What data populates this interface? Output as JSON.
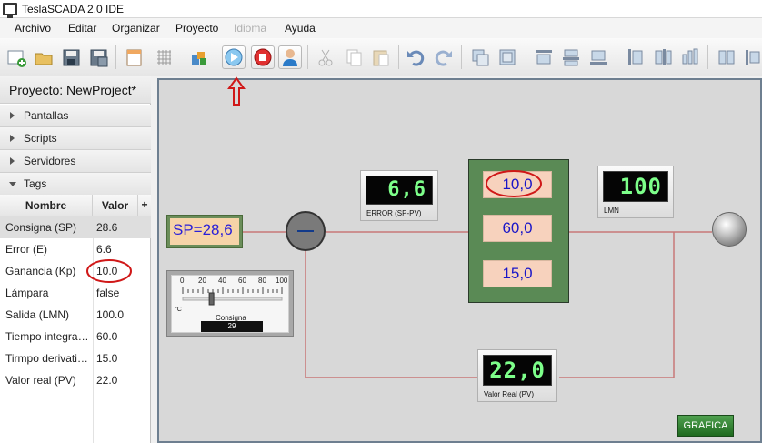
{
  "window": {
    "title": "TeslaSCADA 2.0 IDE"
  },
  "menu": [
    {
      "label": "Archivo",
      "enabled": true
    },
    {
      "label": "Editar",
      "enabled": true
    },
    {
      "label": "Organizar",
      "enabled": true
    },
    {
      "label": "Proyecto",
      "enabled": true
    },
    {
      "label": "Idioma",
      "enabled": false
    },
    {
      "label": "Ayuda",
      "enabled": true
    }
  ],
  "toolbar": {
    "buttons": [
      "new-icon",
      "open-icon",
      "save-icon",
      "save-all-icon",
      "screen-icon",
      "grid-icon",
      "components-icon",
      "run-icon",
      "stop-icon",
      "user-icon",
      "cut-icon",
      "copy-icon",
      "paste-icon",
      "undo-icon",
      "redo-icon",
      "group-icon",
      "ungroup-icon",
      "align-top-icon",
      "align-middle-icon",
      "align-bottom-icon",
      "align-left-icon",
      "align-center-icon",
      "align-right-icon",
      "distribute-icon",
      "more-icon"
    ]
  },
  "left_panel": {
    "project_title": "Proyecto: NewProject*",
    "sections": [
      "Pantallas",
      "Scripts",
      "Servidores",
      "Tags"
    ],
    "tags_table": {
      "headers": {
        "name": "Nombre",
        "value": "Valor",
        "add": "+"
      },
      "rows": [
        {
          "name": "Consigna (SP)",
          "value": "28.6"
        },
        {
          "name": "Error (E)",
          "value": "6.6"
        },
        {
          "name": "Ganancia (Kp)",
          "value": "10.0"
        },
        {
          "name": "Lámpara",
          "value": "false"
        },
        {
          "name": "Salida (LMN)",
          "value": "100.0"
        },
        {
          "name": "Tiempo integral (Ti)",
          "value": "60.0"
        },
        {
          "name": "Tirmpo derivativo (Td)",
          "value": "15.0"
        },
        {
          "name": "Valor real (PV)",
          "value": "22.0"
        }
      ]
    }
  },
  "canvas": {
    "sp_display": "SP=28,6",
    "error_display": {
      "value": "6,6",
      "label": "ERROR (SP-PV)"
    },
    "pid": {
      "kp": "10,0",
      "ti": "60,0",
      "td": "15,0"
    },
    "lmn_display": {
      "value": "100",
      "label": "LMN"
    },
    "pv_display": {
      "value": "22,0",
      "label": "Valor Real (PV)"
    },
    "gauge": {
      "ticks": [
        "0",
        "20",
        "40",
        "60",
        "80",
        "100"
      ],
      "unit": "°C",
      "label": "Consigna",
      "value": "29",
      "fraction": 0.29
    },
    "grafica_button": "GRAFICA",
    "colors": {
      "wire": "#c87878",
      "pid_panel": "#5a8a55",
      "digital_text": "#7dff8a",
      "highlight": "#d01818"
    }
  }
}
